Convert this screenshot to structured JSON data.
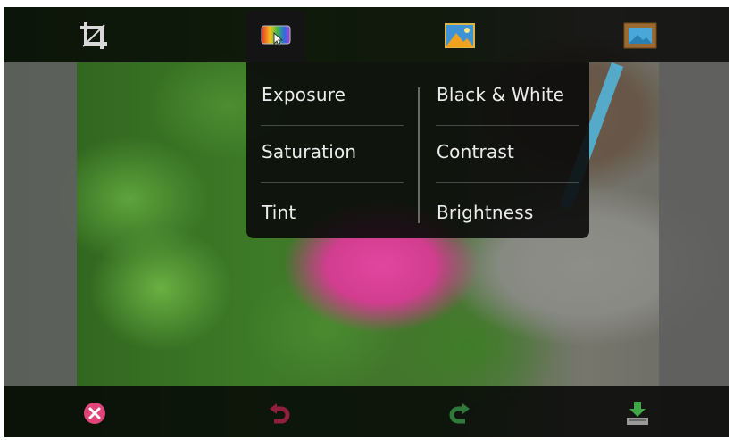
{
  "toolbar": {
    "tools": [
      {
        "name": "crop",
        "icon": "crop-icon"
      },
      {
        "name": "color",
        "icon": "color-adjust-icon",
        "active": true
      },
      {
        "name": "effects",
        "icon": "picture-icon"
      },
      {
        "name": "frame",
        "icon": "framed-picture-icon"
      }
    ]
  },
  "menu": {
    "items": [
      "Exposure",
      "Black & White",
      "Saturation",
      "Contrast",
      "Tint",
      "Brightness"
    ]
  },
  "bottom": {
    "buttons": [
      {
        "icon": "cancel-icon"
      },
      {
        "icon": "undo-icon"
      },
      {
        "icon": "redo-icon"
      },
      {
        "icon": "save-icon"
      }
    ]
  },
  "colors": {
    "cancel": "#e0457a",
    "undo": "#8f1f3a",
    "redo": "#2f7a3a",
    "bar": "#050505"
  }
}
